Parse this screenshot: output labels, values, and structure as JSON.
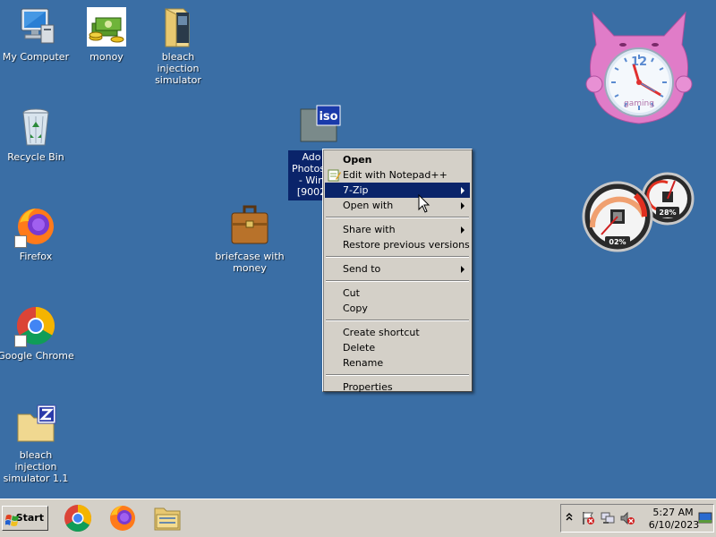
{
  "desktop": {
    "icons": [
      {
        "label": "My Computer"
      },
      {
        "label": "monoy"
      },
      {
        "label": "bleach injection simulator"
      },
      {
        "label": "Recycle Bin"
      },
      {
        "label": "Firefox"
      },
      {
        "label": "briefcase with money"
      },
      {
        "label": "Google Chrome"
      },
      {
        "label": "bleach injection simulator 1.1"
      }
    ],
    "selected_file": {
      "label_lines": [
        "Ado",
        "Photosh",
        "- Win",
        "[9002"
      ],
      "icon_text": "iso"
    }
  },
  "context_menu": {
    "items": [
      {
        "label": "Open"
      },
      {
        "label": "Edit with Notepad++"
      },
      {
        "label": "7-Zip"
      },
      {
        "label": "Open with"
      },
      {
        "label": "Share with"
      },
      {
        "label": "Restore previous versions"
      },
      {
        "label": "Send to"
      },
      {
        "label": "Cut"
      },
      {
        "label": "Copy"
      },
      {
        "label": "Create shortcut"
      },
      {
        "label": "Delete"
      },
      {
        "label": "Rename"
      },
      {
        "label": "Properties"
      }
    ]
  },
  "gadgets": {
    "clock": {
      "number": "12",
      "brand": "gaming"
    },
    "meter": {
      "cpu_label": "02%",
      "mem_label": "28%"
    }
  },
  "taskbar": {
    "start_label": "Start",
    "time": "5:27 AM",
    "date": "6/10/2023"
  },
  "colors": {
    "desktop": "#3a6ea5",
    "menu_bg": "#d4d0c8",
    "highlight": "#0a246a"
  }
}
